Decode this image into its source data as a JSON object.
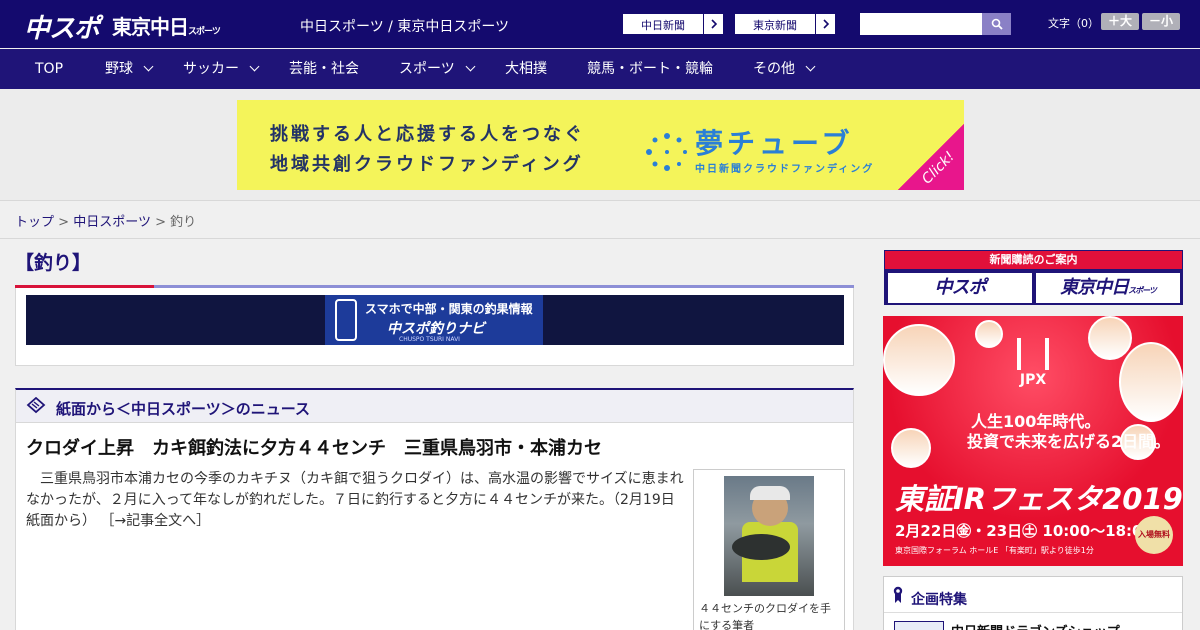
{
  "header": {
    "logo_chuspo": "中スポ",
    "logo_tokyo": "東京中日",
    "logo_tokyo_sub": "スポーツ",
    "site_title": "中日スポーツ / 東京中日スポーツ",
    "ext_links": [
      "中日新聞",
      "東京新聞"
    ],
    "search_placeholder": "",
    "fontsize_label": "文字（0）",
    "fontsize_up": "＋大",
    "fontsize_down": "－小"
  },
  "nav": {
    "items": [
      {
        "label": "TOP",
        "has_menu": false
      },
      {
        "label": "野球",
        "has_menu": true
      },
      {
        "label": "サッカー",
        "has_menu": true
      },
      {
        "label": "芸能・社会",
        "has_menu": false
      },
      {
        "label": "スポーツ",
        "has_menu": true
      },
      {
        "label": "大相撲",
        "has_menu": false
      },
      {
        "label": "競馬・ボート・競輪",
        "has_menu": false
      },
      {
        "label": "その他",
        "has_menu": true
      }
    ]
  },
  "banner": {
    "line1": "挑戦する人と応援する人をつなぐ",
    "line2": "地域共創クラウドファンディング",
    "brand": "夢チューブ",
    "brand_sub": "中日新聞クラウドファンディング",
    "click": "Click!"
  },
  "breadcrumb": {
    "items": [
      "トップ",
      "中日スポーツ"
    ],
    "current": "釣り",
    "separator": ">"
  },
  "section": {
    "heading": "【釣り】"
  },
  "navi_banner": {
    "line1": "スマホで中部・関東の釣果情報",
    "line2": "中スポ釣りナビ",
    "line3": "CHUSPO TSURI NAVI"
  },
  "news": {
    "heading": "紙面から＜中日スポーツ＞のニュース",
    "title": "クロダイ上昇　カキ餌釣法に夕方４４センチ　三重県鳥羽市・本浦カセ",
    "body": "三重県鳥羽市本浦カセの今季のカキチヌ（カキ餌で狙うクロダイ）は、高水温の影響でサイズに恵まれなかったが、２月に入って年なしが釣れだした。７日に釣行すると夕方に４４センチが来た。（2月19日 紙面から）",
    "more_link": "［→記事全文へ］",
    "photo_caption": "４４センチのクロダイを手にする筆者"
  },
  "sidebar": {
    "subscribe_title": "新聞購読のご案内",
    "subscribe_buttons": [
      "中スポ",
      "東京中日"
    ],
    "subscribe_button_sub": "スポーツ",
    "ad": {
      "logo": "JPX",
      "copy1": "人生100年時代。",
      "copy2": "投資で未来を広げる2日間。",
      "title": "東証IRフェスタ2019",
      "date": "2月22日㊎・23日㊏ 10:00～18:00",
      "venue": "東京国際フォーラム ホールE 「有楽町」駅より徒歩1分",
      "badge": "入場無料"
    },
    "kikaku_title": "企画特集",
    "kikaku_item": "中日新聞ドラゴンズショップ"
  },
  "colors": {
    "brand_navy": "#140a6e",
    "nav_bg": "#1f1478",
    "accent_red": "#d8133a",
    "banner_yellow": "#f4f45a",
    "ad_red": "#e60f2e"
  }
}
